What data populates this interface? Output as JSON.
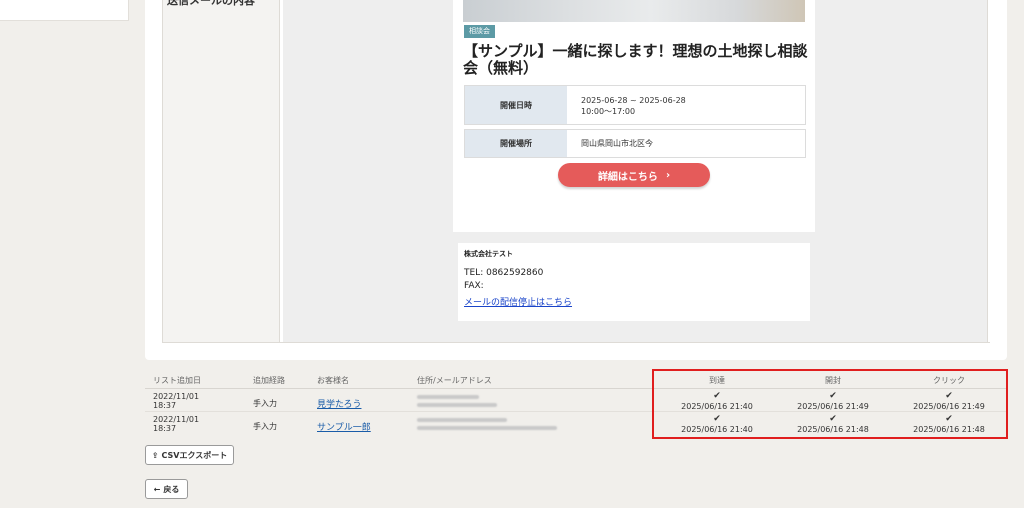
{
  "sidebar": {},
  "field_label": "送信メールの内容",
  "email": {
    "category_tag": "相談会",
    "title": "【サンプル】一緒に探します！理想の土地探し相談会（無料）",
    "info": [
      {
        "key": "開催日時",
        "lines": [
          "2025-06-28 ~ 2025-06-28",
          "10:00〜17:00"
        ]
      },
      {
        "key": "開催場所",
        "lines": [
          "岡山県岡山市北区今"
        ]
      }
    ],
    "detail_button": "詳細はこちら",
    "footer": {
      "company": "株式会社テスト",
      "tel": "TEL: 0862592860",
      "fax": "FAX:",
      "unsubscribe": "メールの配信停止はこちら"
    }
  },
  "table": {
    "headers": {
      "added_date": "リスト追加日",
      "route": "追加経路",
      "customer": "お客様名",
      "address": "住所/メールアドレス",
      "delivered": "到達",
      "opened": "開封",
      "clicked": "クリック"
    },
    "rows": [
      {
        "date": "2022/11/01",
        "time": "18:37",
        "route": "手入力",
        "name": "見学たろう",
        "delivered": "2025/06/16 21:40",
        "opened": "2025/06/16 21:49",
        "clicked": "2025/06/16 21:49"
      },
      {
        "date": "2022/11/01",
        "time": "18:37",
        "route": "手入力",
        "name": "サンプル一郎",
        "delivered": "2025/06/16 21:40",
        "opened": "2025/06/16 21:48",
        "clicked": "2025/06/16 21:48"
      }
    ]
  },
  "buttons": {
    "csv_export": "CSVエクスポート",
    "back": "戻る"
  },
  "icons": {
    "arrow_right": "chevron-right-icon",
    "check": "check-icon",
    "export": "export-icon",
    "back_arrow": "arrow-left-icon"
  },
  "colors": {
    "tag_bg": "#5c9aa5",
    "cta_bg": "#e55b5a",
    "highlight_border": "#e01e1e",
    "link": "#1a5ca8"
  }
}
